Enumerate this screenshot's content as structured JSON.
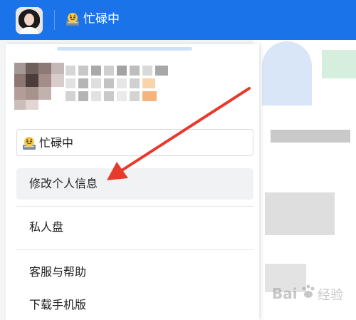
{
  "header": {
    "status_label": "忙碌中",
    "bg_color": "#1a73e8"
  },
  "status_selector": {
    "label": "忙碌中"
  },
  "menu": {
    "items": [
      {
        "label": "修改个人信息",
        "active": true
      },
      {
        "label": "私人盘"
      },
      {
        "label": "客服与帮助"
      },
      {
        "label": "下载手机版"
      }
    ]
  },
  "annotation": {
    "arrow_color": "#e8392d"
  },
  "watermark": {
    "brand": "Bai",
    "cn": "经验"
  }
}
